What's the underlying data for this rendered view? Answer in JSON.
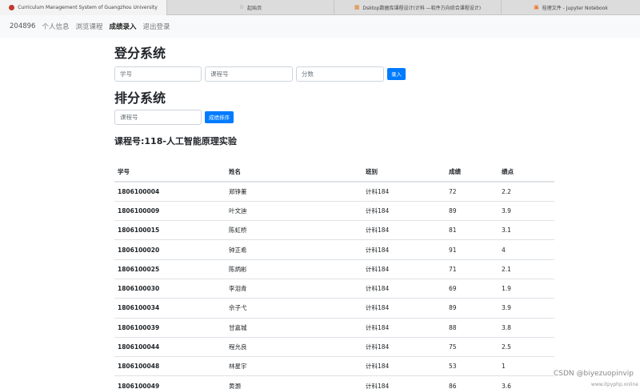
{
  "browser": {
    "tabs": [
      {
        "title": "Curriculum Management System of Guangzhou University",
        "icon": "university-icon"
      },
      {
        "title": "起始页",
        "icon": "star-icon"
      },
      {
        "title": "Dsktop数据库课程设计(计科 —软件方向综合课程设计)",
        "icon": "doc-icon"
      },
      {
        "title": "桂理文件 - Jupyter Notebook",
        "icon": "notebook-icon"
      }
    ]
  },
  "nav": {
    "brand": "204896",
    "items": [
      "个人信息",
      "浏览课程",
      "成绩录入",
      "退出登录"
    ],
    "active_index": 2
  },
  "login": {
    "title": "登分系统",
    "fields": [
      "学号",
      "课程号",
      "分数"
    ],
    "button": "录入"
  },
  "rank": {
    "title": "排分系统",
    "field": "课程号",
    "button": "成绩排序"
  },
  "course": {
    "title": "课程号:118-人工智能原理实验"
  },
  "table": {
    "headers": [
      "学号",
      "姓名",
      "班别",
      "成绩",
      "绩点"
    ],
    "rows": [
      [
        "1806100004",
        "郑铮董",
        "计科184",
        "72",
        "2.2"
      ],
      [
        "1806100009",
        "叶文迪",
        "计科184",
        "89",
        "3.9"
      ],
      [
        "1806100015",
        "陈虹桥",
        "计科184",
        "81",
        "3.1"
      ],
      [
        "1806100020",
        "钟正希",
        "计科184",
        "91",
        "4"
      ],
      [
        "1806100025",
        "陈炳彬",
        "计科184",
        "71",
        "2.1"
      ],
      [
        "1806100030",
        "李泪青",
        "计科184",
        "69",
        "1.9"
      ],
      [
        "1806100034",
        "佘子弋",
        "计科184",
        "89",
        "3.9"
      ],
      [
        "1806100039",
        "甘嘉城",
        "计科184",
        "88",
        "3.8"
      ],
      [
        "1806100044",
        "程允良",
        "计科184",
        "75",
        "2.5"
      ],
      [
        "1806100048",
        "林星宇",
        "计科184",
        "53",
        "1"
      ],
      [
        "1806100049",
        "黄灏",
        "计科184",
        "86",
        "3.6"
      ]
    ]
  },
  "watermark": {
    "text": "CSDN @biyezuopinvip",
    "sub": "www.itpyphp.online"
  },
  "colors": {
    "primary": "#007bff",
    "navbar_bg": "#f8f9fa"
  }
}
